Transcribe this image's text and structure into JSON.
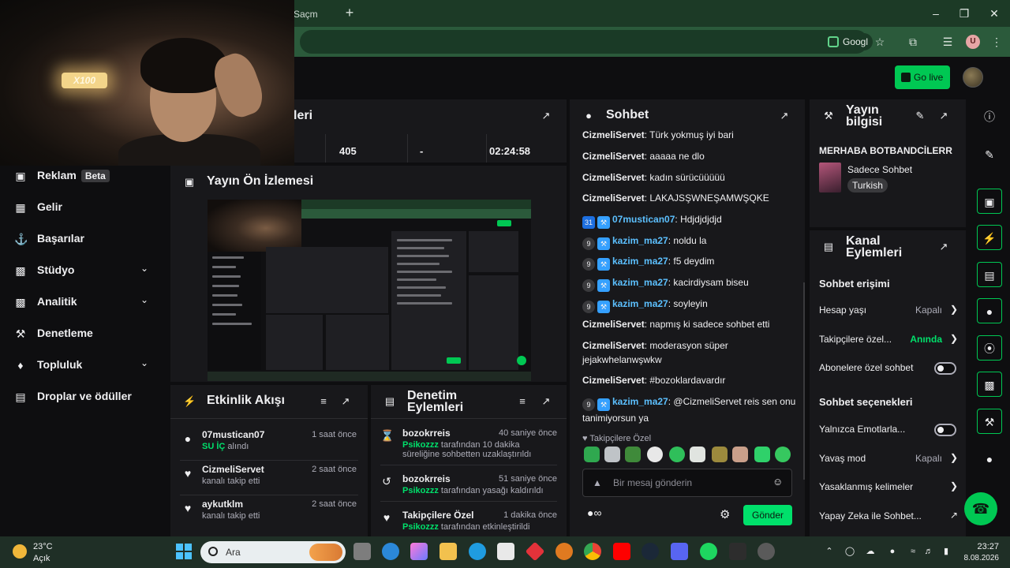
{
  "browser": {
    "tab_title": "Saçm",
    "new_tab": "+",
    "google_chip": "Googl",
    "profile_initial": "U"
  },
  "topnav": {
    "go_live": "Go live"
  },
  "webcam": {
    "sign_text": "X100"
  },
  "sidebar": {
    "items": [
      {
        "label": "Reklam",
        "icon": "ad-icon",
        "badge": "Beta"
      },
      {
        "label": "Gelir",
        "icon": "revenue-icon"
      },
      {
        "label": "Başarılar",
        "icon": "trophy-icon"
      },
      {
        "label": "Stüdyo",
        "icon": "studio-icon",
        "expandable": true
      },
      {
        "label": "Analitik",
        "icon": "analytics-icon",
        "expandable": true
      },
      {
        "label": "Denetleme",
        "icon": "wrench-icon"
      },
      {
        "label": "Topluluk",
        "icon": "community-icon",
        "expandable": true
      },
      {
        "label": "Droplar ve ödüller",
        "icon": "drops-icon"
      }
    ]
  },
  "stats": {
    "title": "leri",
    "values": [
      "405",
      "-",
      "02:24:58"
    ]
  },
  "preview": {
    "title": "Yayın Ön İzlemesi"
  },
  "activity": {
    "title": "Etkinlik Akışı",
    "items": [
      {
        "name": "07mustican07",
        "time": "1 saat önce",
        "highlight": "SU İÇ",
        "desc": "alındı",
        "icon": "reward-icon"
      },
      {
        "name": "CizmeliServet",
        "time": "2 saat önce",
        "desc": "kanalı takip etti",
        "icon": "heart-icon"
      },
      {
        "name": "aykutklm",
        "time": "2 saat önce",
        "desc": "kanalı takip etti",
        "icon": "heart-icon"
      }
    ]
  },
  "mod_actions": {
    "title_line1": "Denetim",
    "title_line2": "Eylemleri",
    "items": [
      {
        "name": "bozokrreis",
        "time": "40 saniye önce",
        "actor": "Psikozzz",
        "desc": "tarafından 10 dakika süreliğine sohbetten uzaklaştırıldı",
        "icon": "hourglass-icon"
      },
      {
        "name": "bozokrreis",
        "time": "51 saniye önce",
        "actor": "Psikozzz",
        "desc": "tarafından yasağı kaldırıldı",
        "icon": "undo-icon"
      },
      {
        "name": "Takipçilere Özel",
        "time": "1 dakika önce",
        "actor": "Psikozzz",
        "desc": "tarafından etkinleştirildi",
        "icon": "heart-icon"
      }
    ]
  },
  "chat": {
    "title": "Sohbet",
    "messages": [
      {
        "user": "CizmeliServet",
        "text": "Türk yokmuş iyi bari"
      },
      {
        "user": "CizmeliServet",
        "text": "aaaaa ne dlo"
      },
      {
        "user": "CizmeliServet",
        "text": "kadın sürücüüüüü"
      },
      {
        "user": "CizmeliServet",
        "text": "LAKAJSŞWNEŞAMWŞQKE"
      },
      {
        "user": "07mustican07",
        "text": "Hdjdjdjdjd",
        "badge": "31",
        "mod": true,
        "color": "blue"
      },
      {
        "user": "kazim_ma27",
        "text": "noldu la",
        "badge": "9",
        "mod": true,
        "color": "blue"
      },
      {
        "user": "kazim_ma27",
        "text": "f5 deydim",
        "badge": "9",
        "mod": true,
        "color": "blue"
      },
      {
        "user": "kazim_ma27",
        "text": "kacirdiysam biseu",
        "badge": "9",
        "mod": true,
        "color": "blue"
      },
      {
        "user": "kazim_ma27",
        "text": "soyleyin",
        "badge": "9",
        "mod": true,
        "color": "blue"
      },
      {
        "user": "CizmeliServet",
        "text": "napmış ki sadece sohbet etti"
      },
      {
        "user": "CizmeliServet",
        "text": "moderasyon süper jejakwhelanwşwkw"
      },
      {
        "user": "CizmeliServet",
        "text": "#bozoklardavardır"
      },
      {
        "user": "kazim_ma27",
        "text": "@CizmeliServet reis sen onu tanimiyorsun ya",
        "badge": "9",
        "mod": true,
        "color": "blue"
      }
    ],
    "followers_only": "Takipçilere Özel",
    "input_placeholder": "Bir mesaj gönderin",
    "send_label": "Gönder",
    "points_icon": "channel-points-icon"
  },
  "stream_info": {
    "title_line1": "Yayın",
    "title_line2": "bilgisi",
    "stream_title": "MERHABA BOTBANDCİLERR",
    "category": "Sadece Sohbet",
    "tag": "Turkish"
  },
  "channel_actions": {
    "title_line1": "Kanal",
    "title_line2": "Eylemleri",
    "chat_access_head": "Sohbet erişimi",
    "account_age_label": "Hesap yaşı",
    "account_age_value": "Kapalı",
    "followers_only_label": "Takipçilere özel...",
    "followers_only_value": "Anında",
    "subs_only_label": "Abonelere özel sohbet",
    "chat_options_head": "Sohbet seçenekleri",
    "emote_only_label": "Yalnızca Emotlarla...",
    "slow_mode_label": "Yavaş mod",
    "slow_mode_value": "Kapalı",
    "banned_words_label": "Yasaklanmış kelimeler",
    "ai_label": "Yapay Zeka ile Sohbet..."
  },
  "taskbar": {
    "temp": "23°C",
    "condition": "Açık",
    "search_placeholder": "Ara",
    "time": "23:27",
    "date": "8.08.2026"
  },
  "colors": {
    "accent_green": "#00c853",
    "chat_mod_blue": "#5cc0ff",
    "panel_bg": "#18181b",
    "page_bg": "#0e0e10"
  }
}
